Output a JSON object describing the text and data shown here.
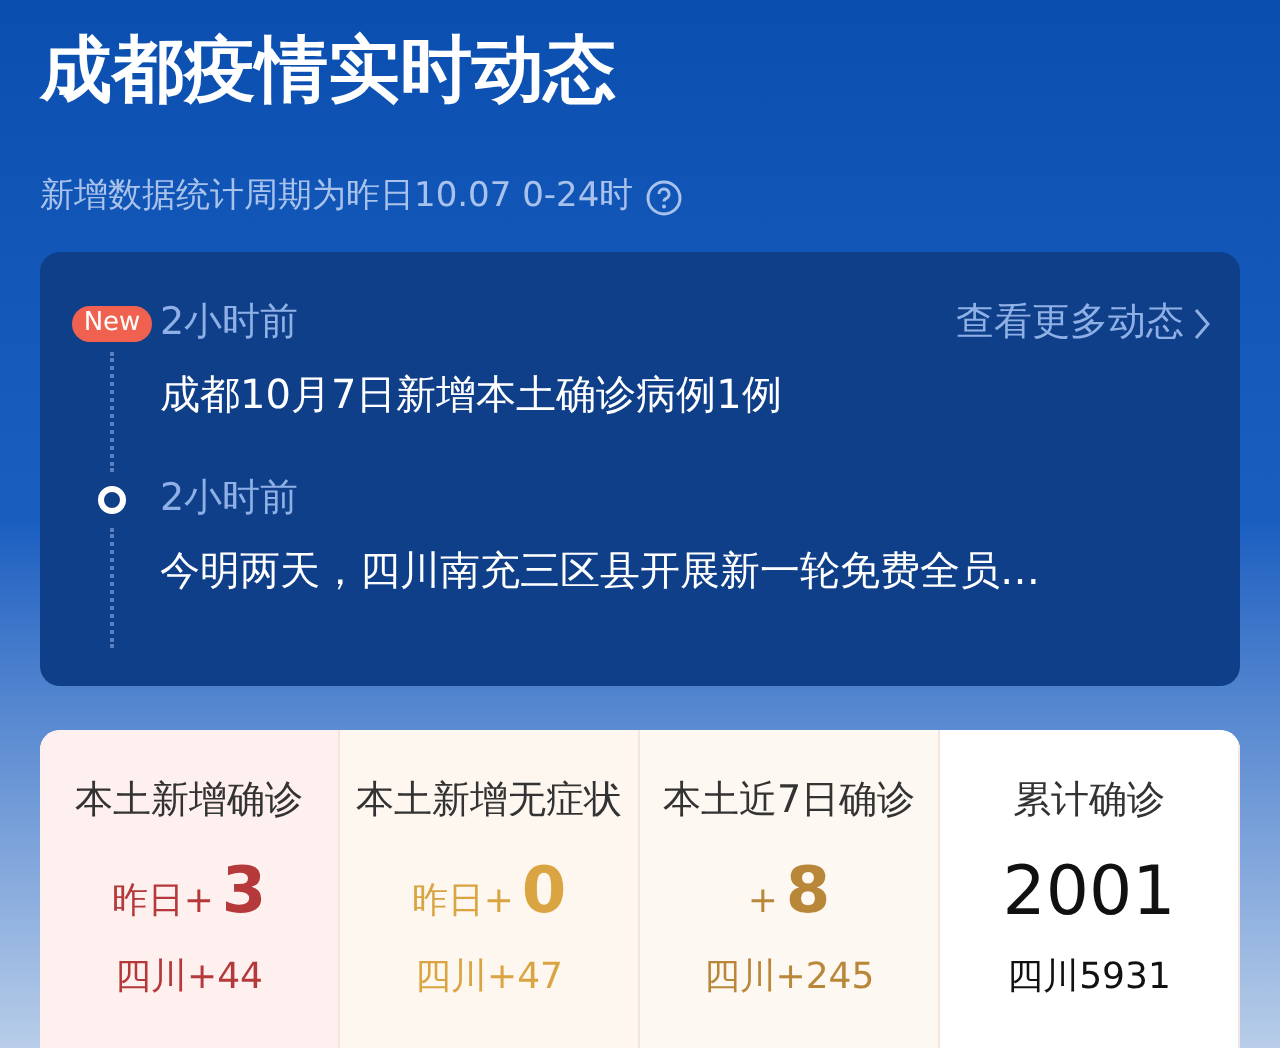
{
  "header": {
    "title": "成都疫情实时动态",
    "subtitle": "新增数据统计周期为昨日10.07 0-24时"
  },
  "updates": {
    "more_link": "查看更多动态",
    "items": [
      {
        "kind": "new",
        "badge": "New",
        "time": "2小时前",
        "text": "成都10月7日新增本土确诊病例1例"
      },
      {
        "kind": "dot",
        "time": "2小时前",
        "text": "今明两天，四川南充三区县开展新一轮免费全员…"
      }
    ]
  },
  "stats": [
    {
      "label": "本土新增确诊",
      "prefix": "昨日+",
      "value": "3",
      "sub": "四川+44",
      "color": "#b5393a"
    },
    {
      "label": "本土新增无症状",
      "prefix": "昨日+",
      "value": "0",
      "sub": "四川+47",
      "color": "#d9a441"
    },
    {
      "label": "本土近7日确诊",
      "prefix": "+",
      "value": "8",
      "sub": "四川+245",
      "color": "#b8873a"
    },
    {
      "label": "累计确诊",
      "value": "2001",
      "sub": "四川5931",
      "color": "#111111"
    }
  ]
}
